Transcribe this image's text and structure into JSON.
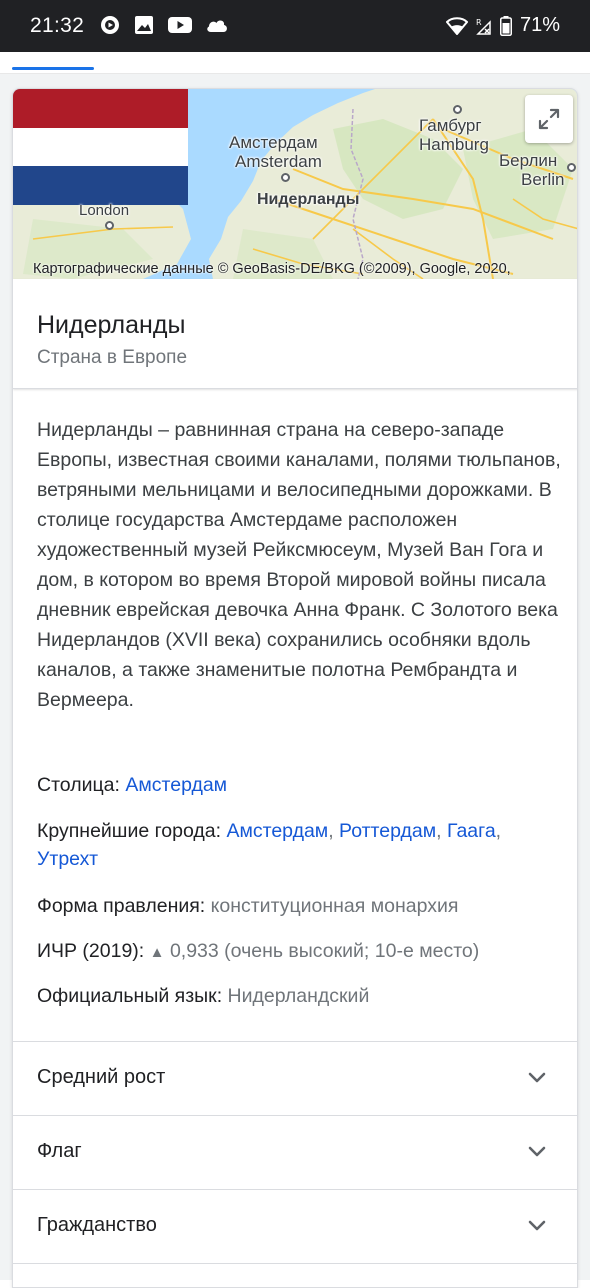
{
  "status_bar": {
    "time": "21:32",
    "battery": "71%",
    "icons": [
      "notification-circle-icon",
      "image-icon",
      "youtube-icon",
      "cloud-icon",
      "wifi-icon",
      "signal-icon",
      "battery-icon"
    ]
  },
  "map": {
    "labels": {
      "amsterdam_ru": "Амстердам",
      "amsterdam_en": "Amsterdam",
      "hamburg_ru": "Гамбург",
      "hamburg_en": "Hamburg",
      "berlin_ru": "Берлин",
      "berlin_en": "Berlin",
      "netherlands": "Нидерланды",
      "london": "London"
    },
    "attribution": "Картографические данные © GeoBasis-DE/BKG (©2009), Google, 2020,",
    "flag_colors": [
      "#ae1c28",
      "#ffffff",
      "#21468b"
    ]
  },
  "entity": {
    "title": "Нидерланды",
    "subtitle": "Страна в Европе"
  },
  "description": "Нидерланды – равнинная страна на северо-западе Европы, известная своими каналами, полями тюльпанов, ветряными мельницами и велосипедными дорожками. В столице государства Амстердаме расположен художественный музей Рейксмюсеум, Музей Ван Гога и дом, в котором во время Второй мировой войны писала дневник еврейская девочка Анна Франк. С Золотого века Нидерландов (XVII века) сохранились особняки вдоль каналов, а также знаменитые полотна Рембрандта и Вермеера.",
  "facts": {
    "capital": {
      "label": "Столица:",
      "value": "Амстердам"
    },
    "largest_cities": {
      "label": "Крупнейшие города:",
      "cities": [
        "Амстердам",
        "Роттердам",
        "Гаага",
        "Утрехт"
      ]
    },
    "government": {
      "label": "Форма правления:",
      "value": "конституционная монархия"
    },
    "hdi": {
      "label": "ИЧР (2019):",
      "arrow": "▲",
      "value": "0,933 (очень высокий; 10-е место)"
    },
    "language": {
      "label": "Официальный язык:",
      "value": "Нидерландский"
    }
  },
  "expanders": [
    {
      "label": "Средний рост"
    },
    {
      "label": "Флаг"
    },
    {
      "label": "Гражданство"
    }
  ],
  "colors": {
    "link": "#1558d6",
    "accent": "#1a73e8",
    "muted": "#70757a"
  }
}
